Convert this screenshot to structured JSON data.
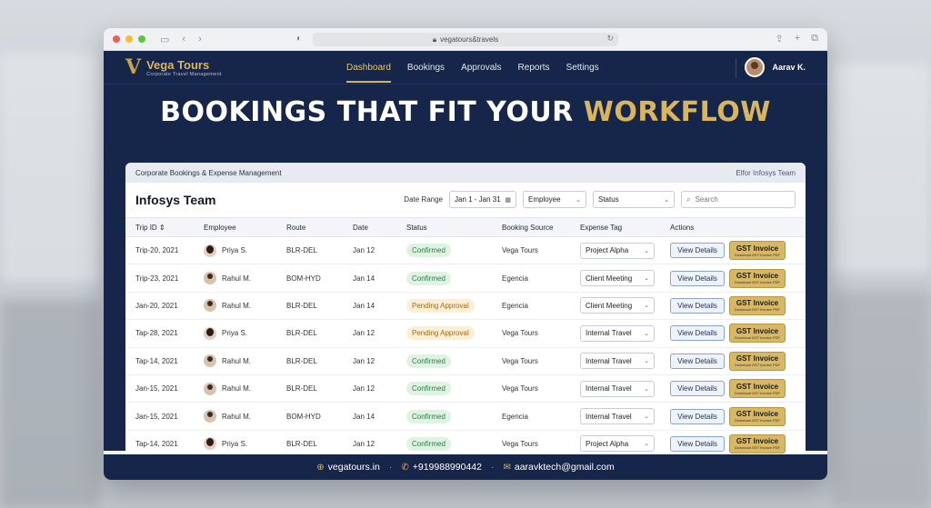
{
  "browser": {
    "url": "vegatours&travels"
  },
  "brand": {
    "name": "Vega Tours",
    "tagline": "Corporate Travel Management"
  },
  "nav": {
    "items": [
      {
        "label": "Dashboard",
        "active": true
      },
      {
        "label": "Bookings",
        "active": false
      },
      {
        "label": "Approvals",
        "active": false
      },
      {
        "label": "Reports",
        "active": false
      },
      {
        "label": "Settings",
        "active": false
      }
    ],
    "user_name": "Aarav K."
  },
  "headline": {
    "part1": "BOOKINGS THAT FIT YOUR ",
    "part2": "WORKFLOW"
  },
  "panel": {
    "subtitle": "Corporate Bookings & Expense Management",
    "context": "Elfor Infosys Team",
    "team_title": "Infosys Team",
    "filters": {
      "date_range_label": "Date Range",
      "date_range_value": "Jan 1 - Jan 31",
      "employee_value": "Employee",
      "status_value": "Status",
      "search_placeholder": "Search"
    },
    "columns": [
      "Trip ID",
      "Employee",
      "Route",
      "Date",
      "Status",
      "Booking Source",
      "Expense Tag",
      "Actions"
    ],
    "view_label": "View Details",
    "gst_label": "GST Invoice",
    "gst_sub": "Download GST Invoice PDF",
    "rows": [
      {
        "trip": "Trip-20, 2021",
        "employee": "Priya S.",
        "gender": "f",
        "route": "BLR-DEL",
        "date": "Jan 12",
        "status": "Confirmed",
        "status_type": "ok",
        "source": "Vega Tours",
        "tag": "Project Alpha"
      },
      {
        "trip": "Trip-23, 2021",
        "employee": "Rahul M.",
        "gender": "m",
        "route": "BOM-HYD",
        "date": "Jan 14",
        "status": "Confirmed",
        "status_type": "ok",
        "source": "Egencia",
        "tag": "Client Meeting"
      },
      {
        "trip": "Jan-20, 2021",
        "employee": "Rahul M.",
        "gender": "m",
        "route": "BLR-DEL",
        "date": "Jan 14",
        "status": "Pending Approval",
        "status_type": "pend",
        "source": "Egencia",
        "tag": "Client Meeting"
      },
      {
        "trip": "Tap-28, 2021",
        "employee": "Priya S.",
        "gender": "f",
        "route": "BLR-DEL",
        "date": "Jan 12",
        "status": "Pending Approval",
        "status_type": "pend",
        "source": "Vega Tours",
        "tag": "Internal Travel"
      },
      {
        "trip": "Tap-14, 2021",
        "employee": "Rahul M.",
        "gender": "m",
        "route": "BLR-DEL",
        "date": "Jan 12",
        "status": "Confirmed",
        "status_type": "ok",
        "source": "Vega Tours",
        "tag": "Internal Travel"
      },
      {
        "trip": "Jan-15, 2021",
        "employee": "Rahul M.",
        "gender": "m",
        "route": "BLR-DEL",
        "date": "Jan 12",
        "status": "Confirmed",
        "status_type": "ok",
        "source": "Vega Tours",
        "tag": "Internal Travel"
      },
      {
        "trip": "Jan-15, 2021",
        "employee": "Rahul M.",
        "gender": "m",
        "route": "BOM-HYD",
        "date": "Jan 14",
        "status": "Confirmed",
        "status_type": "ok",
        "source": "Egencia",
        "tag": "Internal Travel"
      },
      {
        "trip": "Tap-14, 2021",
        "employee": "Priya S.",
        "gender": "f",
        "route": "BLR-DEL",
        "date": "Jan 12",
        "status": "Confirmed",
        "status_type": "ok",
        "source": "Vega Tours",
        "tag": "Project Alpha"
      }
    ]
  },
  "footer": {
    "website": "vegatours.in",
    "phone": "+919988990442",
    "email": "aaravktech@gmail.com"
  },
  "colors": {
    "navy": "#15264a",
    "gold": "#d9b560"
  }
}
